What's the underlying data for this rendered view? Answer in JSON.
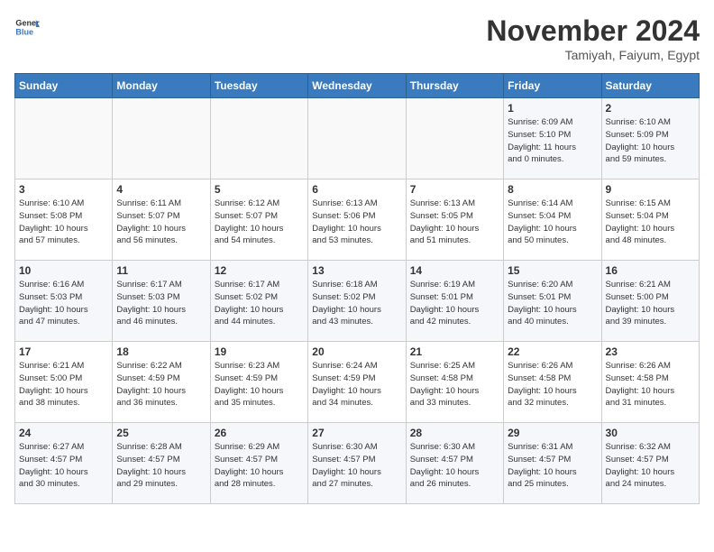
{
  "header": {
    "logo_line1": "General",
    "logo_line2": "Blue",
    "month": "November 2024",
    "location": "Tamiyah, Faiyum, Egypt"
  },
  "weekdays": [
    "Sunday",
    "Monday",
    "Tuesday",
    "Wednesday",
    "Thursday",
    "Friday",
    "Saturday"
  ],
  "weeks": [
    [
      {
        "day": "",
        "info": ""
      },
      {
        "day": "",
        "info": ""
      },
      {
        "day": "",
        "info": ""
      },
      {
        "day": "",
        "info": ""
      },
      {
        "day": "",
        "info": ""
      },
      {
        "day": "1",
        "info": "Sunrise: 6:09 AM\nSunset: 5:10 PM\nDaylight: 11 hours\nand 0 minutes."
      },
      {
        "day": "2",
        "info": "Sunrise: 6:10 AM\nSunset: 5:09 PM\nDaylight: 10 hours\nand 59 minutes."
      }
    ],
    [
      {
        "day": "3",
        "info": "Sunrise: 6:10 AM\nSunset: 5:08 PM\nDaylight: 10 hours\nand 57 minutes."
      },
      {
        "day": "4",
        "info": "Sunrise: 6:11 AM\nSunset: 5:07 PM\nDaylight: 10 hours\nand 56 minutes."
      },
      {
        "day": "5",
        "info": "Sunrise: 6:12 AM\nSunset: 5:07 PM\nDaylight: 10 hours\nand 54 minutes."
      },
      {
        "day": "6",
        "info": "Sunrise: 6:13 AM\nSunset: 5:06 PM\nDaylight: 10 hours\nand 53 minutes."
      },
      {
        "day": "7",
        "info": "Sunrise: 6:13 AM\nSunset: 5:05 PM\nDaylight: 10 hours\nand 51 minutes."
      },
      {
        "day": "8",
        "info": "Sunrise: 6:14 AM\nSunset: 5:04 PM\nDaylight: 10 hours\nand 50 minutes."
      },
      {
        "day": "9",
        "info": "Sunrise: 6:15 AM\nSunset: 5:04 PM\nDaylight: 10 hours\nand 48 minutes."
      }
    ],
    [
      {
        "day": "10",
        "info": "Sunrise: 6:16 AM\nSunset: 5:03 PM\nDaylight: 10 hours\nand 47 minutes."
      },
      {
        "day": "11",
        "info": "Sunrise: 6:17 AM\nSunset: 5:03 PM\nDaylight: 10 hours\nand 46 minutes."
      },
      {
        "day": "12",
        "info": "Sunrise: 6:17 AM\nSunset: 5:02 PM\nDaylight: 10 hours\nand 44 minutes."
      },
      {
        "day": "13",
        "info": "Sunrise: 6:18 AM\nSunset: 5:02 PM\nDaylight: 10 hours\nand 43 minutes."
      },
      {
        "day": "14",
        "info": "Sunrise: 6:19 AM\nSunset: 5:01 PM\nDaylight: 10 hours\nand 42 minutes."
      },
      {
        "day": "15",
        "info": "Sunrise: 6:20 AM\nSunset: 5:01 PM\nDaylight: 10 hours\nand 40 minutes."
      },
      {
        "day": "16",
        "info": "Sunrise: 6:21 AM\nSunset: 5:00 PM\nDaylight: 10 hours\nand 39 minutes."
      }
    ],
    [
      {
        "day": "17",
        "info": "Sunrise: 6:21 AM\nSunset: 5:00 PM\nDaylight: 10 hours\nand 38 minutes."
      },
      {
        "day": "18",
        "info": "Sunrise: 6:22 AM\nSunset: 4:59 PM\nDaylight: 10 hours\nand 36 minutes."
      },
      {
        "day": "19",
        "info": "Sunrise: 6:23 AM\nSunset: 4:59 PM\nDaylight: 10 hours\nand 35 minutes."
      },
      {
        "day": "20",
        "info": "Sunrise: 6:24 AM\nSunset: 4:59 PM\nDaylight: 10 hours\nand 34 minutes."
      },
      {
        "day": "21",
        "info": "Sunrise: 6:25 AM\nSunset: 4:58 PM\nDaylight: 10 hours\nand 33 minutes."
      },
      {
        "day": "22",
        "info": "Sunrise: 6:26 AM\nSunset: 4:58 PM\nDaylight: 10 hours\nand 32 minutes."
      },
      {
        "day": "23",
        "info": "Sunrise: 6:26 AM\nSunset: 4:58 PM\nDaylight: 10 hours\nand 31 minutes."
      }
    ],
    [
      {
        "day": "24",
        "info": "Sunrise: 6:27 AM\nSunset: 4:57 PM\nDaylight: 10 hours\nand 30 minutes."
      },
      {
        "day": "25",
        "info": "Sunrise: 6:28 AM\nSunset: 4:57 PM\nDaylight: 10 hours\nand 29 minutes."
      },
      {
        "day": "26",
        "info": "Sunrise: 6:29 AM\nSunset: 4:57 PM\nDaylight: 10 hours\nand 28 minutes."
      },
      {
        "day": "27",
        "info": "Sunrise: 6:30 AM\nSunset: 4:57 PM\nDaylight: 10 hours\nand 27 minutes."
      },
      {
        "day": "28",
        "info": "Sunrise: 6:30 AM\nSunset: 4:57 PM\nDaylight: 10 hours\nand 26 minutes."
      },
      {
        "day": "29",
        "info": "Sunrise: 6:31 AM\nSunset: 4:57 PM\nDaylight: 10 hours\nand 25 minutes."
      },
      {
        "day": "30",
        "info": "Sunrise: 6:32 AM\nSunset: 4:57 PM\nDaylight: 10 hours\nand 24 minutes."
      }
    ]
  ]
}
